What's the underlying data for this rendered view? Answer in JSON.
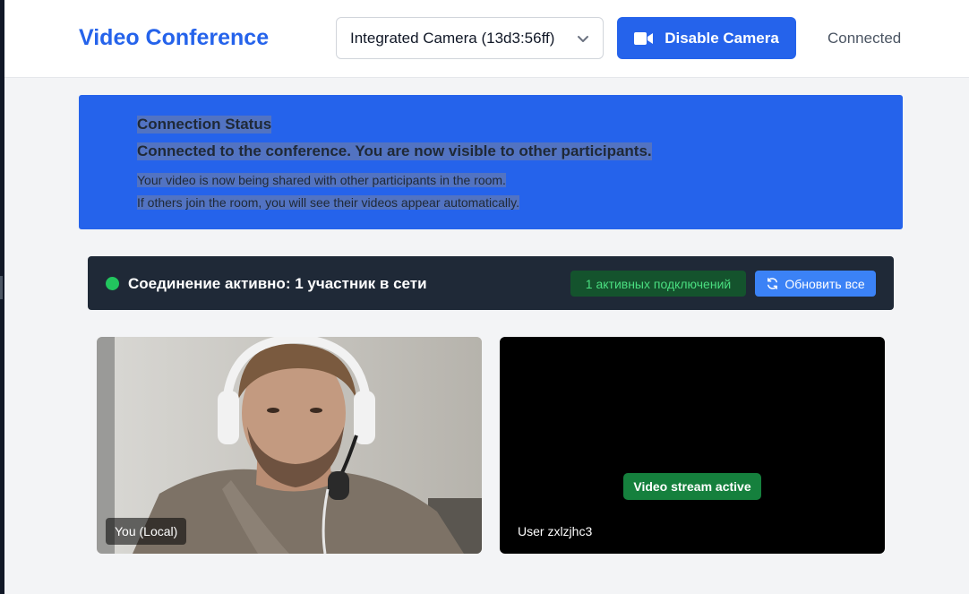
{
  "header": {
    "title": "Video Conference",
    "camera_select": {
      "selected": "Integrated Camera (13d3:56ff)"
    },
    "camera_button_label": "Disable Camera",
    "connection_status": "Connected"
  },
  "banner": {
    "title": "Connection Status",
    "message": "Connected to the conference. You are now visible to other participants.",
    "detail_1": "Your video is now being shared with other participants in the room.",
    "detail_2": "If others join the room, you will see their videos appear automatically."
  },
  "status_bar": {
    "text": "Соединение активно: 1 участник в сети",
    "badge": "1 активных подключений",
    "refresh_label": "Обновить все"
  },
  "videos": [
    {
      "label": "You (Local)"
    },
    {
      "label": "User zxlzjhc3",
      "badge": "Video stream active"
    }
  ],
  "colors": {
    "accent": "#2563eb",
    "status_bar_bg": "#1f2937",
    "online": "#22c55e",
    "stream_active": "#15803d"
  }
}
